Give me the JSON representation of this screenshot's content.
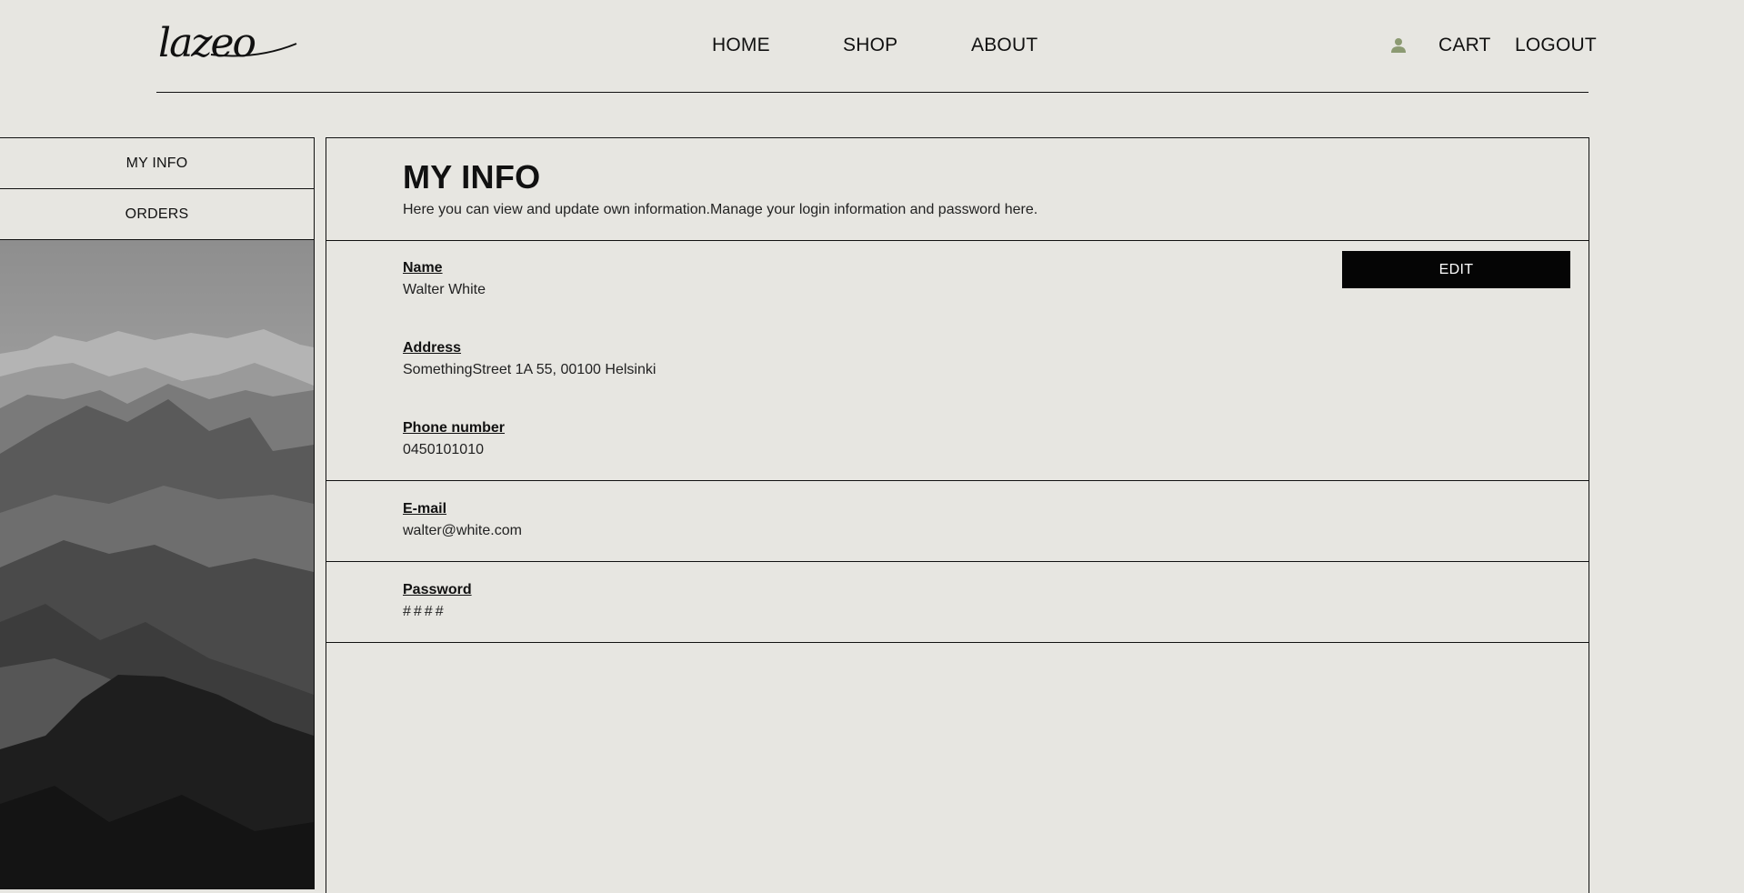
{
  "brand": {
    "logo_text": "lazeo"
  },
  "nav": {
    "home": "HOME",
    "shop": "SHOP",
    "about": "ABOUT",
    "cart": "CART",
    "logout": "LOGOUT"
  },
  "icons": {
    "user": "user-icon"
  },
  "colors": {
    "background": "#e7e6e1",
    "accent_icon": "#8c9a72",
    "button": "#050505"
  },
  "sidebar": {
    "items": [
      {
        "label": "MY INFO"
      },
      {
        "label": "ORDERS"
      }
    ]
  },
  "page": {
    "title": "MY INFO",
    "description": "Here you can view and update own information.Manage your login information and password here."
  },
  "profile": {
    "edit_label": "EDIT",
    "name_label": "Name",
    "name_value": "Walter White",
    "address_label": "Address",
    "address_value": "SomethingStreet 1A 55, 00100 Helsinki",
    "phone_label": "Phone number",
    "phone_value": "0450101010",
    "email_label": "E-mail",
    "email_value": "walter@white.com",
    "password_label": "Password",
    "password_value": "####"
  }
}
